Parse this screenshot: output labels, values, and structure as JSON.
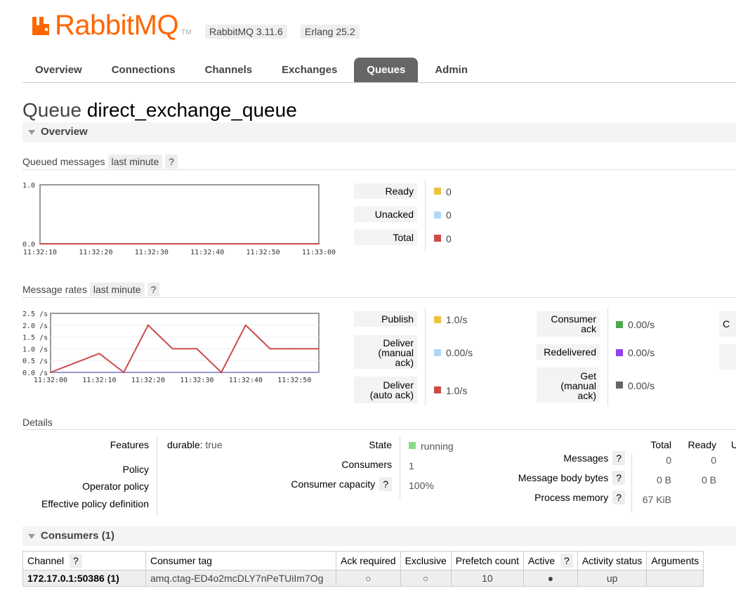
{
  "header": {
    "brand": "RabbitMQ",
    "tm": "TM",
    "version_badge": "RabbitMQ 3.11.6",
    "erlang_badge": "Erlang 25.2",
    "brand_color": "#ff6600"
  },
  "tabs": [
    {
      "label": "Overview"
    },
    {
      "label": "Connections"
    },
    {
      "label": "Channels"
    },
    {
      "label": "Exchanges"
    },
    {
      "label": "Queues",
      "active": true
    },
    {
      "label": "Admin"
    }
  ],
  "page": {
    "title_prefix": "Queue",
    "queue_name": "direct_exchange_queue"
  },
  "overview_section": {
    "label": "Overview"
  },
  "queued": {
    "heading": "Queued messages",
    "range": "last minute",
    "help": "?",
    "legend": [
      {
        "label": "Ready",
        "value": "0",
        "color": "#edc240"
      },
      {
        "label": "Unacked",
        "value": "0",
        "color": "#afd8f8"
      },
      {
        "label": "Total",
        "value": "0",
        "color": "#cb4b4b"
      }
    ]
  },
  "rates": {
    "heading": "Message rates",
    "range": "last minute",
    "help": "?",
    "col1": [
      {
        "label": "Publish",
        "value": "1.0/s",
        "color": "#edc240"
      },
      {
        "label": "Deliver\n(manual\nack)",
        "value": "0.00/s",
        "color": "#afd8f8"
      },
      {
        "label": "Deliver\n(auto ack)",
        "value": "1.0/s",
        "color": "#cb4b4b"
      }
    ],
    "col2": [
      {
        "label": "Consumer\nack",
        "value": "0.00/s",
        "color": "#4da74d"
      },
      {
        "label": "Redelivered",
        "value": "0.00/s",
        "color": "#9440ed"
      },
      {
        "label": "Get\n(manual\nack)",
        "value": "0.00/s",
        "color": "#666666"
      }
    ],
    "col3_partial": "C"
  },
  "chart_data": [
    {
      "type": "line",
      "x": [
        "11:32:10",
        "11:32:20",
        "11:32:30",
        "11:32:40",
        "11:32:50",
        "11:33:00"
      ],
      "ylim": [
        0,
        1.0
      ],
      "yticks": [
        "1.0",
        "0.0"
      ],
      "series": [
        {
          "name": "Total",
          "values": [
            0,
            0,
            0,
            0,
            0,
            0
          ],
          "color": "#cb4b4b"
        }
      ]
    },
    {
      "type": "line",
      "x": [
        "11:32:00",
        "11:32:05",
        "11:32:10",
        "11:32:15",
        "11:32:20",
        "11:32:25",
        "11:32:30",
        "11:32:35",
        "11:32:40",
        "11:32:45",
        "11:32:50",
        "11:32:55"
      ],
      "xticks": [
        "11:32:00",
        "11:32:10",
        "11:32:20",
        "11:32:30",
        "11:32:40",
        "11:32:50"
      ],
      "ylim": [
        0,
        2.5
      ],
      "yticks": [
        "2.5 /s",
        "2.0 /s",
        "1.5 /s",
        "1.0 /s",
        "0.5 /s",
        "0.0 /s"
      ],
      "series": [
        {
          "name": "Publish",
          "values": [
            0,
            0.4,
            0.8,
            0,
            2.0,
            1.0,
            1.0,
            0,
            2.0,
            1.0,
            1.0,
            1.0
          ],
          "color": "#cb4b4b"
        },
        {
          "name": "Deliver (manual ack)",
          "values": [
            0,
            0,
            0,
            0,
            0,
            0,
            0,
            0,
            0,
            0,
            0,
            0
          ],
          "color": "#9999cc"
        }
      ]
    }
  ],
  "details": {
    "heading": "Details",
    "left": [
      {
        "key": "Features",
        "value_key": "durable:",
        "value": "true"
      },
      {
        "key": "Policy",
        "value": ""
      },
      {
        "key": "Operator policy",
        "value": ""
      },
      {
        "key": "Effective policy definition",
        "value": ""
      }
    ],
    "state_label": "State",
    "state_value": "running",
    "state_color": "#88dd88",
    "consumers_label": "Consumers",
    "consumers_value": "1",
    "capacity_label": "Consumer capacity",
    "capacity_help": "?",
    "capacity_value": "100%",
    "stats_headers": [
      "Total",
      "Ready",
      "U"
    ],
    "stats": [
      {
        "label": "Messages",
        "help": "?",
        "total": "0",
        "ready": "0"
      },
      {
        "label": "Message body bytes",
        "help": "?",
        "total": "0 B",
        "ready": "0 B"
      },
      {
        "label": "Process memory",
        "help": "?",
        "total": "67 KiB",
        "ready": ""
      }
    ]
  },
  "consumers_section": {
    "label": "Consumers (1)",
    "headers": [
      "Channel",
      "Consumer tag",
      "Ack required",
      "Exclusive",
      "Prefetch count",
      "Active",
      "Activity status",
      "Arguments"
    ],
    "help": "?",
    "rows": [
      {
        "channel": "172.17.0.1:50386 (1)",
        "tag": "amq.ctag-ED4o2mcDLY7nPeTUiIm7Og",
        "ack": "○",
        "exclusive": "○",
        "prefetch": "10",
        "active": "●",
        "status": "up",
        "arguments": ""
      }
    ]
  }
}
